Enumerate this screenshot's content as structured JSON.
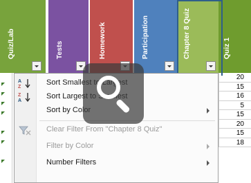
{
  "columns": [
    {
      "label": "Quiz/Lab"
    },
    {
      "label": "Tests"
    },
    {
      "label": "Homework"
    },
    {
      "label": "Participation"
    },
    {
      "label": "Chapter 8 Quiz"
    },
    {
      "label": "Quiz 1"
    }
  ],
  "colors": {
    "quizlab": "#78a33c",
    "tests": "#7b52a1",
    "homework": "#c0504d",
    "participation": "#4f81bd",
    "chapter8": "#9bbb59",
    "quiz1": "#6f9c2e"
  },
  "menu": {
    "sort_asc": "Sort Smallest to Largest",
    "sort_desc": "Sort Largest to Smallest",
    "sort_color": "Sort by Color",
    "clear_filter": "Clear Filter From \"Chapter 8 Quiz\"",
    "filter_color": "Filter by Color",
    "number_filters": "Number Filters"
  },
  "icons": {
    "sort_asc": "sort-ascending-icon",
    "sort_desc": "sort-descending-icon",
    "clear_filter": "clear-filter-icon",
    "zoom": "magnifier-icon"
  },
  "quiz1_values": [
    "20",
    "15",
    "16",
    "5",
    "15",
    "20",
    "15",
    "18"
  ]
}
